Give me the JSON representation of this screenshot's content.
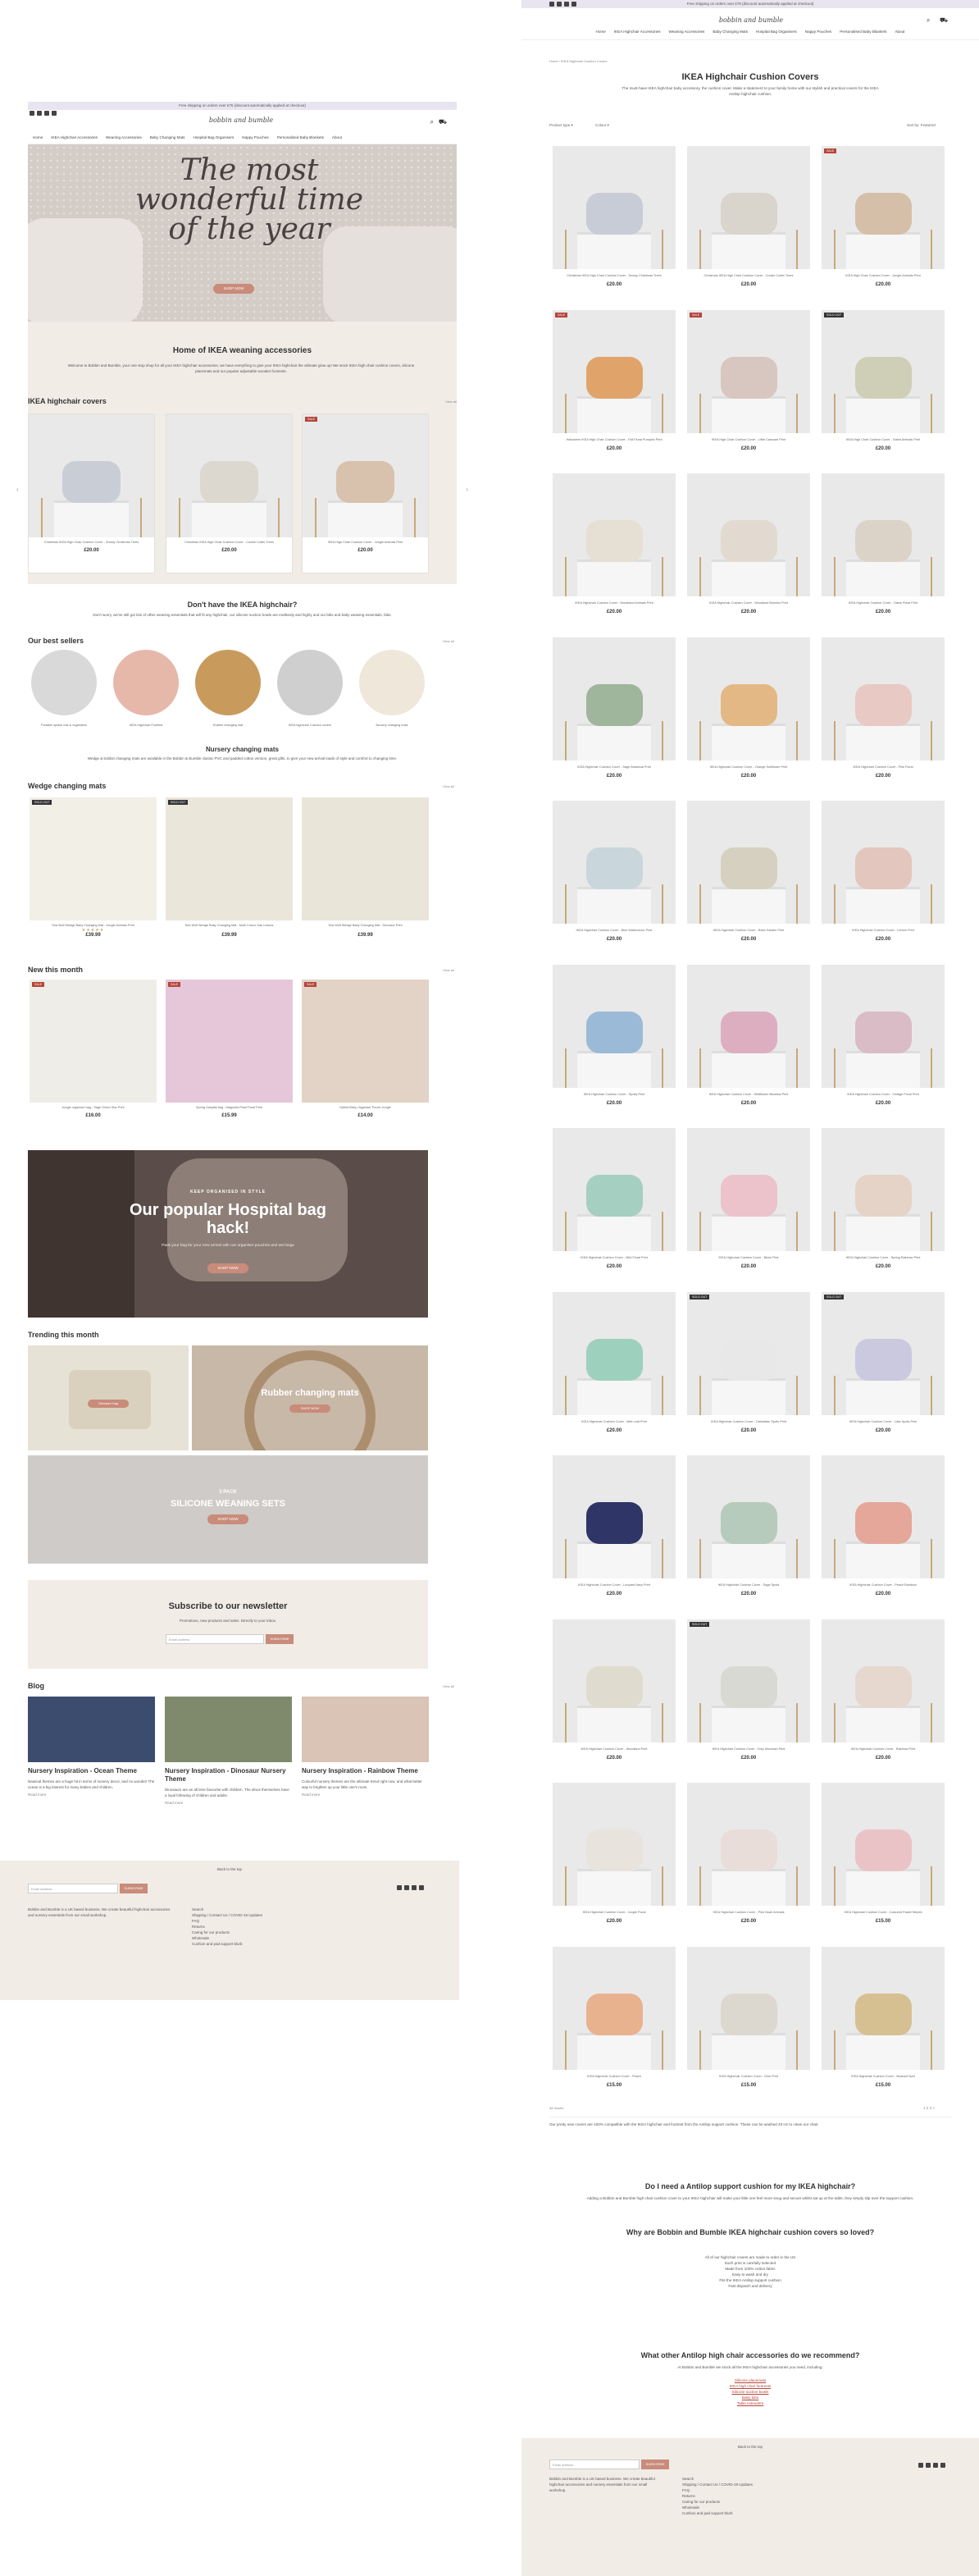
{
  "announcement": "Free shipping on orders over £75 (discount automatically applied at checkout)",
  "brand": {
    "logo": "bobbin and bumble"
  },
  "nav": [
    "Home",
    "IKEA Highchair Accessories",
    "Weaning Accessories",
    "Baby Changing Mats",
    "Hospital Bag Organisers",
    "Nappy Pouches",
    "Personalised Baby Blankets",
    "About"
  ],
  "hero": {
    "title": "The most wonderful time of the year",
    "cta": "SHOP NOW"
  },
  "home": {
    "heading": "Home of IKEA weaning accessories",
    "intro": "Welcome to Bobbin and Bumble, your one stop shop for all your IKEA highchair accessories, we have everything to give your IKEA highchair the ultimate glow up! We stock IKEA high chair cushion covers, silicone placemats and our popular adjustable wooden footrests.",
    "cushions_title": "IKEA highchair covers",
    "view_all": "View all",
    "cushions": [
      {
        "title": "Christmas IKEA High Chair Cushion Cover - Snowy Christmas Trees",
        "price": "£20.00",
        "color": "#c9ced6",
        "badge": ""
      },
      {
        "title": "Christmas IKEA High Chair Cushion Cover - Cookie Cutter Trees",
        "price": "£20.00",
        "color": "#dcd7cf",
        "badge": ""
      },
      {
        "title": "IKEA High Chair Cushion Cover - Jungle Animals Print",
        "price": "£20.00",
        "color": "#d8c2ad",
        "badge": "SALE"
      }
    ],
    "no_ikea_title": "Don't have the IKEA highchair?",
    "no_ikea_text": "Don't worry, we've still got lots of other weaning essentials that will fit any highchair, our silicone suction bowls are endlessly and highly and our bibs and baby weaning essentials, bibs.",
    "best_title": "Our best sellers",
    "best": [
      "Portable splash mat & organisers",
      "IKEA Highchair Footrest",
      "Rubber changing mat",
      "IKEA highchair Cushion covers",
      "Nursery changing mats"
    ],
    "nursery_title": "Nursery changing mats",
    "nursery_text": "Wedge & bobbin changing mats are available in the Bobbin & Bumble classic PVC and padded cotton version, great gifts, to give your new arrival loads of style and comfort to changing time.",
    "wedge_title": "Wedge changing mats",
    "wedges": [
      {
        "title": "Sea Wolf Wedge Baby Changing Mat - Jungle Animals Print",
        "price": "£39.99",
        "badge": "SOLD OUT"
      },
      {
        "title": "Sea Wolf Wedge Baby Changing Mat - Multi Colour Oak Leaves",
        "price": "£39.99",
        "badge": "SOLD OUT"
      },
      {
        "title": "Sea Wolf Wedge Baby Changing Mat - Dinosaur Print",
        "price": "£39.99",
        "badge": ""
      }
    ],
    "new_title": "New this month",
    "new_items": [
      {
        "title": "Jungle organiser bag - Sage Green Star Print",
        "price": "£16.00",
        "badge": "SALE"
      },
      {
        "title": "Spring Hospital bag - Magnolia Petal Floral Print",
        "price": "£15.99",
        "badge": "SALE"
      },
      {
        "title": "Hybrid Baby Organiser Pouch Jungle",
        "price": "£14.00",
        "badge": "SALE"
      }
    ],
    "hospital_kicker": "KEEP ORGANISED IN STYLE",
    "hospital_title": "Our popular Hospital bag hack!",
    "hospital_text": "Pack your bag for your new arrival with our organiser pouches and wet bags",
    "shop_now": "SHOP NOW",
    "trending_title": "Trending this month",
    "trending_a": "Dinosaur bag",
    "trending_b": "Rubber changing mats",
    "silicone_kicker": "3 PACK",
    "silicone_title": "SILICONE WEANING SETS",
    "newsletter_title": "Subscribe to our newsletter",
    "newsletter_text": "Promotions, new products and sales. Directly to your inbox.",
    "email_placeholder": "Email address",
    "subscribe": "SUBSCRIBE",
    "blog_title": "Blog",
    "blogs": [
      {
        "title": "Nursery Inspiration - Ocean Theme",
        "text": "Nautical themes are a huge hit in terms of nursery decor, and no wonder! The ocean is a big interest for many babies and children.",
        "more": "Read more"
      },
      {
        "title": "Nursery Inspiration - Dinosaur Nursery Theme",
        "text": "Dinosaurs are an all time favourite with children. The dinos themselves have a loyal following of children and adults.",
        "more": "Read more"
      },
      {
        "title": "Nursery Inspiration - Rainbow Theme",
        "text": "Colourful nursery themes are the ultimate trend right now, and what better way to brighten up your little one's room.",
        "more": "Read more"
      }
    ]
  },
  "footer": {
    "back_to_top": "Back to the top",
    "email_placeholder": "Email address",
    "subscribe": "SUBSCRIBE",
    "about": "Bobbin and Bumble is a UK based business. We create beautiful highchair accessories and nursery essentials from our small workshop.",
    "links": [
      "Search",
      "Shipping / Contact Us / COVID-19 Updates",
      "FAQ",
      "Returns",
      "Caring for our products",
      "Wholesale",
      "Cushion and pad support blurb"
    ]
  },
  "collection": {
    "breadcrumb": "Home / IKEA Highchair Cushion Covers",
    "title": "IKEA Highchair Cushion Covers",
    "intro": "The must-have IKEA highchair baby accessory, the cushion cover. Make a statement to your family home with our stylish and practical covers for the IKEA Antilop highchair cushion.",
    "filter_type": "Product type",
    "filter_colour": "Colour",
    "sort": "Sort by: Featured",
    "products": [
      {
        "t": "Christmas IKEA High Chair Cushion Cover - Snowy Christmas Trees",
        "p": "£20.00",
        "c": "#c7ccd6",
        "b": ""
      },
      {
        "t": "Christmas IKEA High Chair Cushion Cover - Cookie Cutter Trees",
        "p": "£20.00",
        "c": "#d9d4cc",
        "b": ""
      },
      {
        "t": "IKEA High Chair Cushion Cover - Jungle Animals Print",
        "p": "£20.00",
        "c": "#d5bfa9",
        "b": "SALE"
      },
      {
        "t": "Halloween IKEA High Chair Cushion Cover - Fall Floral Pumpkin Print",
        "p": "£20.00",
        "c": "#e0a46a",
        "b": "SALE"
      },
      {
        "t": "IKEA High Chair Cushion Cover - Little Carousel Print",
        "p": "£20.00",
        "c": "#d7c7c0",
        "b": "SALE"
      },
      {
        "t": "IKEA High Chair Cushion Cover - Safari Animals Print",
        "p": "£20.00",
        "c": "#cfcfb8",
        "b": "SOLD OUT"
      },
      {
        "t": "IKEA Highchair Cushion Cover - Woodland Animals Print",
        "p": "£20.00",
        "c": "#e5dfd4",
        "b": ""
      },
      {
        "t": "IKEA Highchair Cushion Cover - Woodland Bunnies Print",
        "p": "£20.00",
        "c": "#e2dad0",
        "b": ""
      },
      {
        "t": "IKEA Highchair Cushion Cover - Oasis Floral Print",
        "p": "£20.00",
        "c": "#dcd3c8",
        "b": ""
      },
      {
        "t": "IKEA Highchair Cushion Cover - Sage Botanical Print",
        "p": "£20.00",
        "c": "#9fb59c",
        "b": ""
      },
      {
        "t": "IKEA Highchair Cushion Cover - Orange Sunflower Print",
        "p": "£20.00",
        "c": "#e3b885",
        "b": ""
      },
      {
        "t": "IKEA Highchair Cushion Cover - Pink Floral",
        "p": "£20.00",
        "c": "#e8c9c4",
        "b": ""
      },
      {
        "t": "IKEA Highchair Cushion Cover - Blue Watercolour Print",
        "p": "£20.00",
        "c": "#c9d6dc",
        "b": ""
      },
      {
        "t": "IKEA Highchair Cushion Cover - Bees Garden Print",
        "p": "£20.00",
        "c": "#d5d0c0",
        "b": ""
      },
      {
        "t": "IKEA Highchair Cushion Cover - Lemon Print",
        "p": "£20.00",
        "c": "#e3c6bd",
        "b": ""
      },
      {
        "t": "IKEA Highchair Cushion Cover - Spotty Print",
        "p": "£20.00",
        "c": "#9bbad8",
        "b": ""
      },
      {
        "t": "IKEA Highchair Cushion Cover - Wildflower Meadow Print",
        "p": "£20.00",
        "c": "#dcaec0",
        "b": ""
      },
      {
        "t": "IKEA Highchair Cushion Cover - Vintage Floral Print",
        "p": "£20.00",
        "c": "#d9bcc6",
        "b": ""
      },
      {
        "t": "IKEA Highchair Cushion Cover - Mint Floral Print",
        "p": "£20.00",
        "c": "#a5cfc1",
        "b": ""
      },
      {
        "t": "IKEA Highchair Cushion Cover - Blush Pink",
        "p": "£20.00",
        "c": "#ecc2cb",
        "b": ""
      },
      {
        "t": "IKEA Highchair Cushion Cover - Spring Rainbow Print",
        "p": "£20.00",
        "c": "#e4d3c6",
        "b": ""
      },
      {
        "t": "IKEA Highchair Cushion Cover - Mint Leaf Print",
        "p": "£20.00",
        "c": "#9ed1bd",
        "b": ""
      },
      {
        "t": "IKEA Highchair Cushion Cover - Dalmatian Spots Print",
        "p": "£20.00",
        "c": "#e8e8e8",
        "b": "SOLD OUT"
      },
      {
        "t": "IKEA Highchair Cushion Cover - Lilac Spots Print",
        "p": "£20.00",
        "c": "#cbc9df",
        "b": "SOLD OUT"
      },
      {
        "t": "IKEA Highchair Cushion Cover - Leopard Navy Print",
        "p": "£20.00",
        "c": "#2f3566",
        "b": ""
      },
      {
        "t": "IKEA Highchair Cushion Cover - Sage Spots",
        "p": "£20.00",
        "c": "#b6cbbb",
        "b": ""
      },
      {
        "t": "IKEA Highchair Cushion Cover - Peach Rainbow",
        "p": "£20.00",
        "c": "#e4a79a",
        "b": ""
      },
      {
        "t": "IKEA Highchair Cushion Cover - Woodland Print",
        "p": "£20.00",
        "c": "#dfdccf",
        "b": ""
      },
      {
        "t": "IKEA Highchair Cushion Cover - Grey Mountain Print",
        "p": "£20.00",
        "c": "#d9d9d4",
        "b": "SOLD OUT"
      },
      {
        "t": "IKEA Highchair Cushion Cover - Rainbow Print",
        "p": "£20.00",
        "c": "#e6d8cf",
        "b": ""
      },
      {
        "t": "IKEA Highchair Cushion Cover - Jungle Floral",
        "p": "£20.00",
        "c": "#e8e4dd",
        "b": ""
      },
      {
        "t": "IKEA Highchair Cushion Cover - Pink Noah Animals",
        "p": "£20.00",
        "c": "#e8ddd9",
        "b": ""
      },
      {
        "t": "IKEA Highchair Cushion Cover - Coloured Pastel Stripes",
        "p": "£15.00",
        "c": "#eac3c6",
        "b": ""
      },
      {
        "t": "IKEA Highchair Cushion Cover - Peach",
        "p": "£15.00",
        "c": "#e9b28f",
        "b": ""
      },
      {
        "t": "IKEA Highchair Cushion Cover - Dino Print",
        "p": "£15.00",
        "c": "#dcd8cf",
        "b": ""
      },
      {
        "t": "IKEA Highchair Cushion Cover - Mustard Spot",
        "p": "£15.00",
        "c": "#d6c092",
        "b": ""
      }
    ],
    "pagination": "1 2 3 >",
    "seo_intro": "Our pretty new covers are 100% compatible with the IKEA highchair and footrest from the Antilop support cushion. These can be washed 40 Hz to clean our chair.",
    "q1": "Do I need a Antilop support cushion for my IKEA highchair?",
    "a1": "Adding a Bobbin and Bumble high chair cushion cover to your IKEA highchair will make your little one feel more snug and secure whilst sat up at the table, they simply slip over the support cushion.",
    "q2": "Why are Bobbin and Bumble IKEA highchair cushion covers so loved?",
    "reasons": [
      "All of our highchair covers are made to order in the UK",
      "Each print is carefully selected",
      "Made from 100% cotton fabric",
      "Easy to wash and dry",
      "Fits the IKEA Antilop support cushion",
      "Fast dispatch and delivery"
    ],
    "q3": "What other Antilop high chair accessories do we recommend?",
    "a3": "At Bobbin and Bumble we stock all the IKEA highchair accessories you need, including:",
    "acc": [
      "Silicone placemats",
      "IKEA high chair footrests",
      "Silicone suction bowls",
      "Baby bibs",
      "Table extenders"
    ]
  },
  "colors": {
    "accent": "#c98b7a",
    "sale": "#b5453a",
    "beige": "#f1ece6"
  }
}
